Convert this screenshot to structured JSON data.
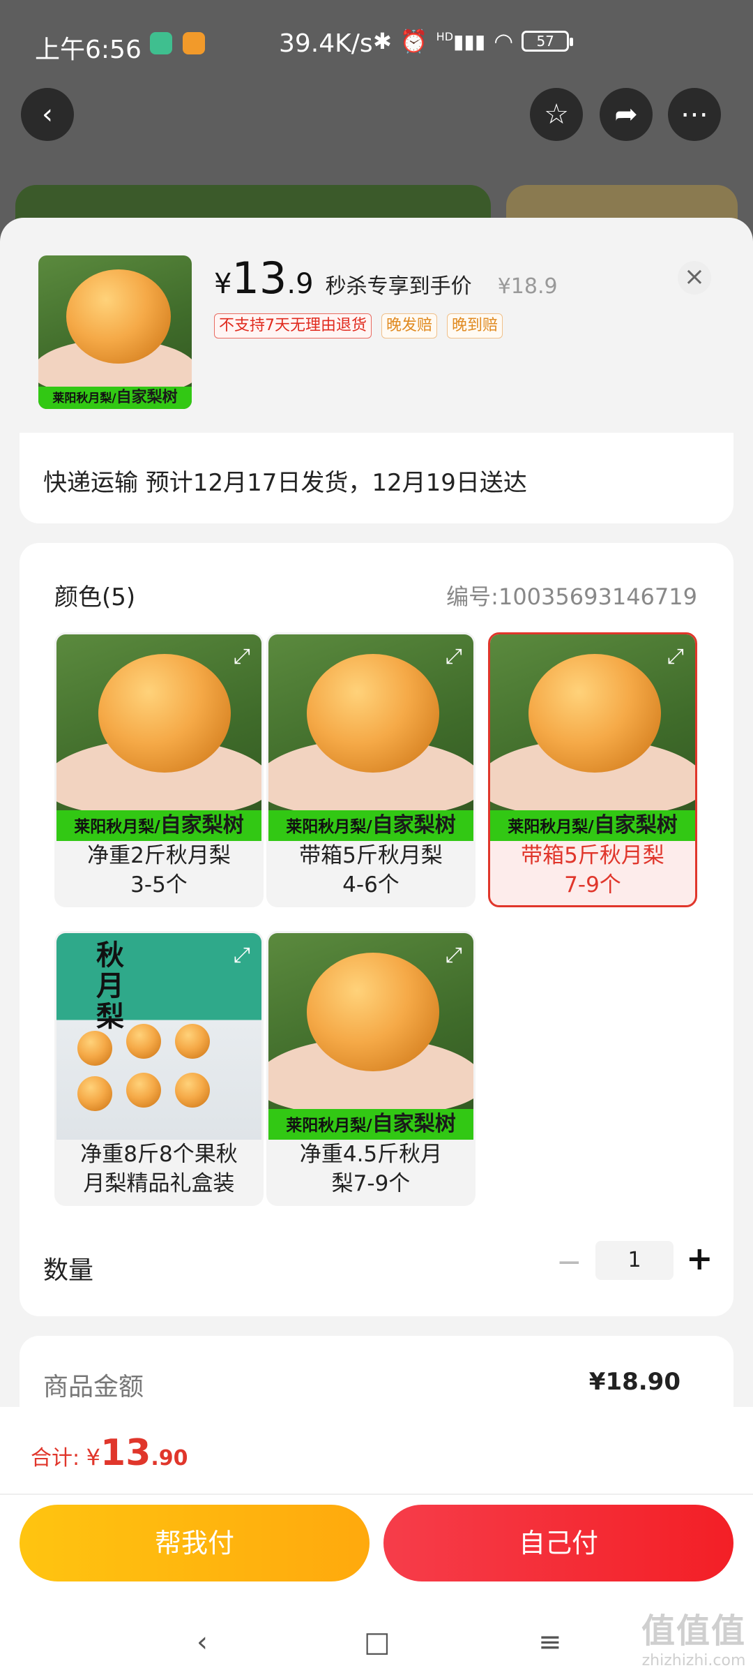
{
  "status_bar": {
    "time": "上午6:56",
    "net_speed": "39.4K/s",
    "signal_label": "HD",
    "battery": "57"
  },
  "product": {
    "image_band_left": "莱阳秋月梨/",
    "image_band_right": "自家梨树",
    "price_currency": "¥",
    "price_integer": "13",
    "price_decimal": ".9",
    "price_label": "秒杀专享到手价",
    "original_price": "¥18.9",
    "tags": [
      "不支持7天无理由退货",
      "晚发赔",
      "晚到赔"
    ]
  },
  "shipping": {
    "text": "快递运输 预计12月17日发货，12月19日送达"
  },
  "options": {
    "header": "颜色(5)",
    "code": "编号:10035693146719",
    "items": [
      {
        "line1": "净重2斤秋月梨",
        "line2": "3-5个"
      },
      {
        "line1": "带箱5斤秋月梨",
        "line2": "4-6个"
      },
      {
        "line1": "带箱5斤秋月梨",
        "line2": "7-9个"
      },
      {
        "line1": "净重8斤8个果秋",
        "line2": "月梨精品礼盒装"
      },
      {
        "line1": "净重4.5斤秋月",
        "line2": "梨7-9个"
      }
    ],
    "gift_box_text": "秋月梨",
    "selected_index": 2
  },
  "quantity": {
    "label": "数量",
    "minus": "−",
    "value": "1",
    "plus": "+"
  },
  "amount": {
    "label": "商品金额",
    "value": "¥18.90"
  },
  "footer": {
    "total_label": "合计: ",
    "total_currency": "¥",
    "total_integer": "13",
    "total_decimal": ".90",
    "help_pay": "帮我付",
    "self_pay": "自己付"
  },
  "nav": {
    "back": "‹",
    "home": "□",
    "menu": "≡"
  },
  "watermark": {
    "big": "值值值",
    "small": "zhizhizhi.com"
  },
  "colors": {
    "accent_red": "#e0362b",
    "yellow_button": "#ffb70e",
    "red_button": "#f32a33"
  }
}
